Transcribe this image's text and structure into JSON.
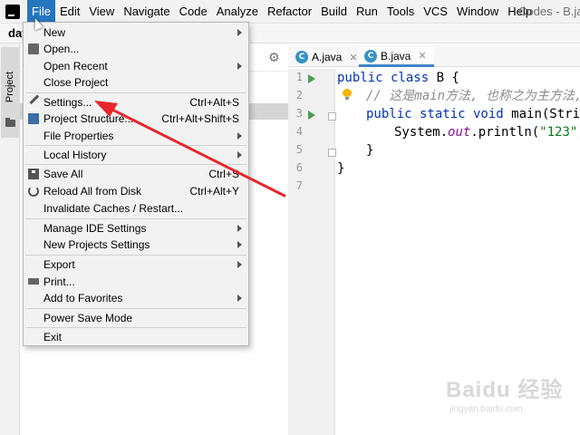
{
  "menubar": {
    "items": [
      "File",
      "Edit",
      "View",
      "Navigate",
      "Code",
      "Analyze",
      "Refactor",
      "Build",
      "Run",
      "Tools",
      "VCS",
      "Window",
      "Help"
    ],
    "window_title": "Codes - B.ja"
  },
  "toolbar": {
    "project_crumb": "day"
  },
  "left_strip": {
    "project_tab": "Project"
  },
  "editor": {
    "tabs": [
      {
        "label": "A.java",
        "icon": "C"
      },
      {
        "label": "B.java",
        "icon": "C"
      }
    ],
    "line_numbers": [
      "1",
      "2",
      "3",
      "4",
      "5",
      "6",
      "7"
    ],
    "code": {
      "l1_kw": "public class ",
      "l1_rest": "B {",
      "l2_comment": "// 这是main方法, 也称之为主方法, 是",
      "l3_kw": "public static void ",
      "l3_rest": "main(String",
      "l4_pre": "System.",
      "l4_field": "out",
      "l4_mid": ".println(",
      "l4_str": "\"123\"",
      "l4_end": ");",
      "l5": "}",
      "l6": "}"
    }
  },
  "file_menu": {
    "items": [
      {
        "label": "New",
        "shortcut": "",
        "submenu": true
      },
      {
        "label": "Open...",
        "shortcut": "",
        "submenu": false
      },
      {
        "label": "Open Recent",
        "shortcut": "",
        "submenu": true
      },
      {
        "label": "Close Project",
        "shortcut": "",
        "submenu": false
      },
      {
        "label": "Settings...",
        "shortcut": "Ctrl+Alt+S",
        "submenu": false
      },
      {
        "label": "Project Structure...",
        "shortcut": "Ctrl+Alt+Shift+S",
        "submenu": false
      },
      {
        "label": "File Properties",
        "shortcut": "",
        "submenu": true
      },
      {
        "label": "Local History",
        "shortcut": "",
        "submenu": true
      },
      {
        "label": "Save All",
        "shortcut": "Ctrl+S",
        "submenu": false
      },
      {
        "label": "Reload All from Disk",
        "shortcut": "Ctrl+Alt+Y",
        "submenu": false
      },
      {
        "label": "Invalidate Caches / Restart...",
        "shortcut": "",
        "submenu": false
      },
      {
        "label": "Manage IDE Settings",
        "shortcut": "",
        "submenu": true
      },
      {
        "label": "New Projects Settings",
        "shortcut": "",
        "submenu": true
      },
      {
        "label": "Export",
        "shortcut": "",
        "submenu": true
      },
      {
        "label": "Print...",
        "shortcut": "",
        "submenu": false
      },
      {
        "label": "Add to Favorites",
        "shortcut": "",
        "submenu": true
      },
      {
        "label": "Power Save Mode",
        "shortcut": "",
        "submenu": false
      },
      {
        "label": "Exit",
        "shortcut": "",
        "submenu": false
      }
    ]
  },
  "watermark": {
    "main": "Baidu 经验",
    "sub": "jingyan.baidu.com"
  },
  "colors": {
    "menu_highlight": "#2675bf",
    "annotation_arrow": "#e8262b",
    "keyword": "#0033b3",
    "string": "#067d17"
  }
}
